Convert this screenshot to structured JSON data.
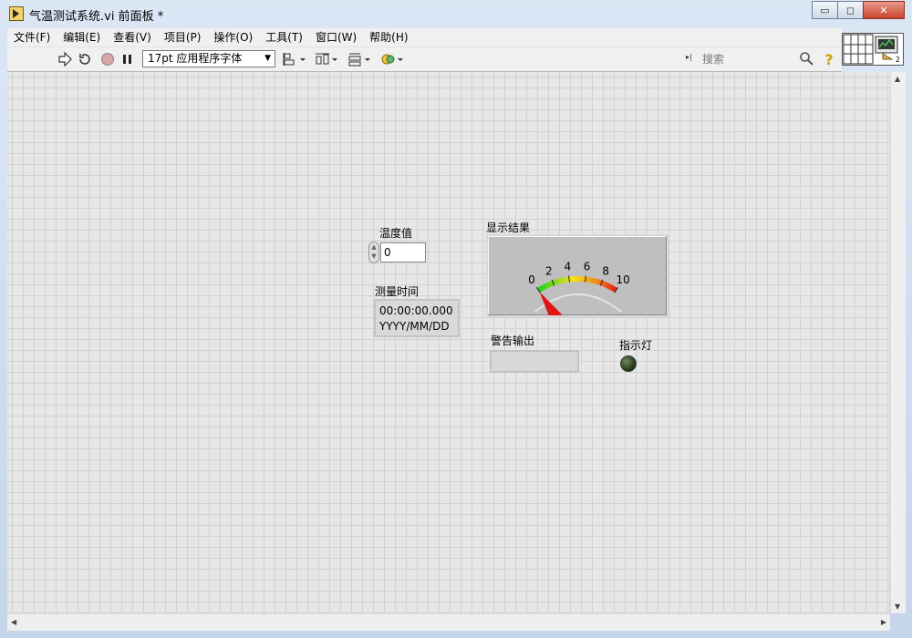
{
  "window": {
    "title": "气温测试系统.vi 前面板 *",
    "controls": {
      "minimize": "▭",
      "maximize": "◻",
      "close": "✕"
    }
  },
  "menu": [
    "文件(F)",
    "编辑(E)",
    "查看(V)",
    "项目(P)",
    "操作(O)",
    "工具(T)",
    "窗口(W)",
    "帮助(H)"
  ],
  "toolbar": {
    "font": "17pt 应用程序字体",
    "search_placeholder": "搜索",
    "icons": [
      "run-arrow-icon",
      "run-continuously-icon",
      "abort-icon",
      "pause-icon",
      "align-icon",
      "distribute-icon",
      "resize-icon",
      "reorder-icon",
      "search-icon",
      "help-icon"
    ]
  },
  "connector_pane": {
    "badge": "2"
  },
  "front_panel": {
    "temperature": {
      "label": "温度值",
      "value": "0"
    },
    "measure_time": {
      "label": "测量时间",
      "time": "00:00:00.000",
      "date": "YYYY/MM/DD"
    },
    "display": {
      "label": "显示结果",
      "scale": [
        "0",
        "2",
        "4",
        "6",
        "8",
        "10"
      ],
      "value": 0,
      "colors": {
        "low": "#1fd21f",
        "mid": "#f7e11b",
        "high": "#e31b1b",
        "needle": "#e01414"
      }
    },
    "alarm_output": {
      "label": "警告输出",
      "value": ""
    },
    "indicator_light": {
      "label": "指示灯",
      "state": "off",
      "color": "#1e3215"
    }
  }
}
